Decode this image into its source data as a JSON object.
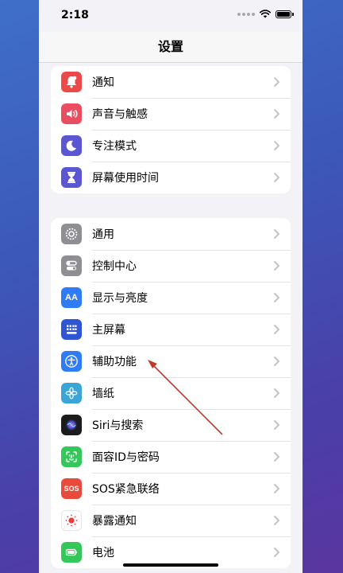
{
  "status_bar": {
    "time": "2:18"
  },
  "nav": {
    "title": "设置"
  },
  "group1": [
    {
      "label": "通知",
      "icon": "bell-icon",
      "color": "#ec4a4a"
    },
    {
      "label": "声音与触感",
      "icon": "speaker-icon",
      "color": "#ea4d5f"
    },
    {
      "label": "专注模式",
      "icon": "moon-icon",
      "color": "#5b57d3"
    },
    {
      "label": "屏幕使用时间",
      "icon": "hourglass-icon",
      "color": "#5b57d3"
    }
  ],
  "group2": [
    {
      "label": "通用",
      "icon": "gear-icon",
      "color": "#8e8e93"
    },
    {
      "label": "控制中心",
      "icon": "toggles-icon",
      "color": "#8e8e93"
    },
    {
      "label": "显示与亮度",
      "icon": "text-size-icon",
      "color": "#2f7cf6"
    },
    {
      "label": "主屏幕",
      "icon": "grid-icon",
      "color": "#2f55d4"
    },
    {
      "label": "辅助功能",
      "icon": "accessibility-icon",
      "color": "#2f7cf6"
    },
    {
      "label": "墙纸",
      "icon": "flower-icon",
      "color": "#3aa5d6"
    },
    {
      "label": "Siri与搜索",
      "icon": "siri-icon",
      "color": "#1c1c1e"
    },
    {
      "label": "面容ID与密码",
      "icon": "face-id-icon",
      "color": "#34c759"
    },
    {
      "label": "SOS紧急联络",
      "icon": "sos-icon",
      "color": "#e84a3c"
    },
    {
      "label": "暴露通知",
      "icon": "exposure-icon",
      "color": "#ffffff"
    },
    {
      "label": "电池",
      "icon": "battery-icon",
      "color": "#34c759"
    }
  ],
  "sos_text": "SOS",
  "display_icon_text": "AA",
  "annotation_color": "#c0392b"
}
